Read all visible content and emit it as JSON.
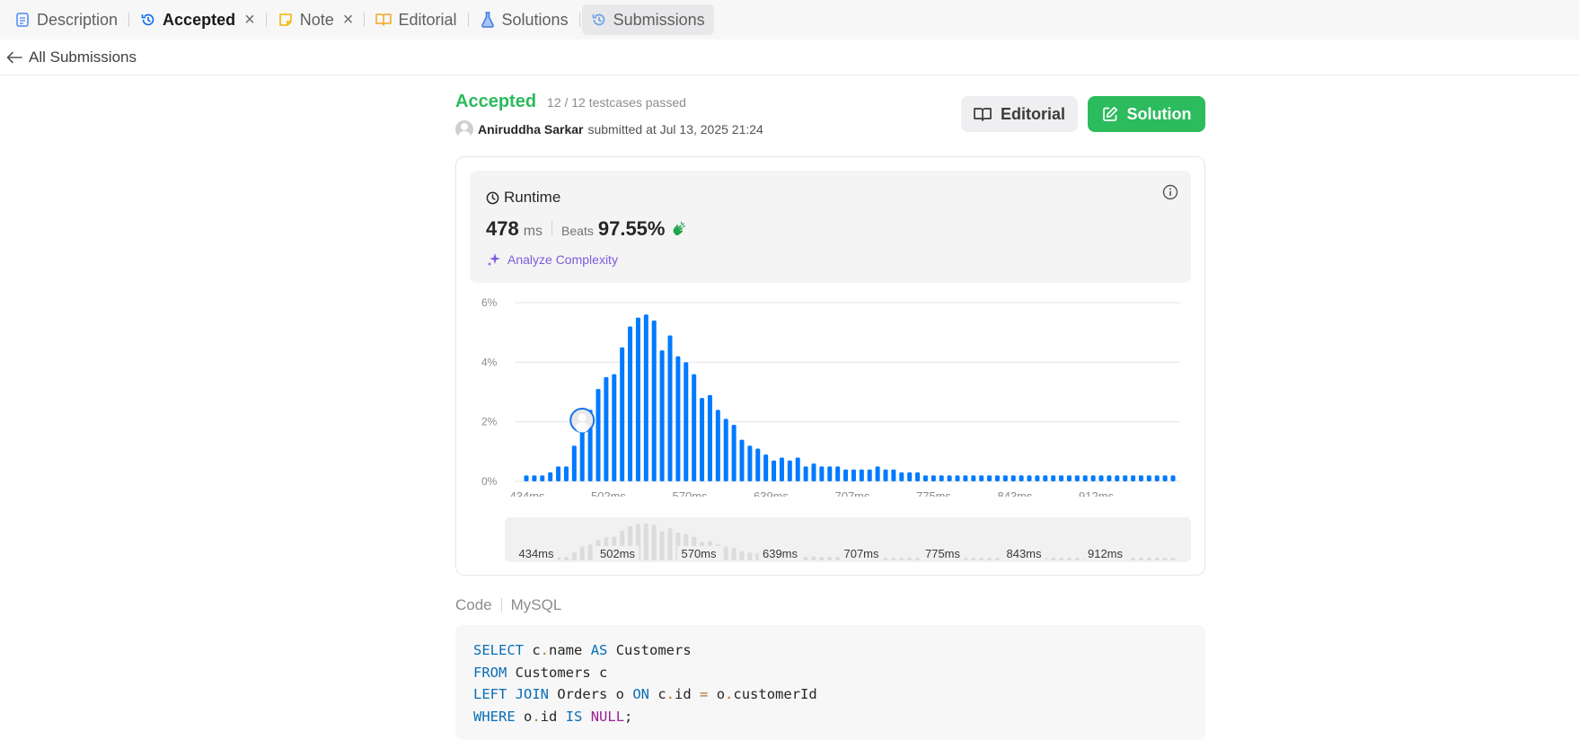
{
  "tabs": [
    {
      "label": "Description",
      "icon": "description-icon"
    },
    {
      "label": "Accepted",
      "icon": "history-icon",
      "active": true,
      "closable": true
    },
    {
      "label": "Note",
      "icon": "note-icon",
      "closable": true
    },
    {
      "label": "Editorial",
      "icon": "book-icon"
    },
    {
      "label": "Solutions",
      "icon": "flask-icon"
    },
    {
      "label": "Submissions",
      "icon": "history-icon",
      "selected": true
    }
  ],
  "subbar": {
    "back_label": "All Submissions"
  },
  "header": {
    "status": "Accepted",
    "testcases": "12 / 12 testcases passed",
    "username": "Aniruddha Sarkar",
    "submitted_text": "submitted at Jul 13, 2025 21:24",
    "editorial_btn": "Editorial",
    "solution_btn": "Solution"
  },
  "runtime": {
    "title": "Runtime",
    "value": "478",
    "unit": "ms",
    "beats_label": "Beats",
    "beats_value": "97.55%",
    "analyze_label": "Analyze Complexity"
  },
  "chart_data": {
    "type": "bar",
    "ylabel": "",
    "xlabel": "",
    "y_ticks": [
      "0%",
      "2%",
      "4%",
      "6%"
    ],
    "ylim": [
      0,
      6
    ],
    "x_tick_labels": [
      "434ms",
      "502ms",
      "570ms",
      "639ms",
      "707ms",
      "775ms",
      "843ms",
      "912ms"
    ],
    "values": [
      0.2,
      0.2,
      0.2,
      0.3,
      0.5,
      0.5,
      1.2,
      2.1,
      2.4,
      3.1,
      3.5,
      3.6,
      4.5,
      5.2,
      5.5,
      5.6,
      5.4,
      4.4,
      4.9,
      4.2,
      4.0,
      3.6,
      2.8,
      2.9,
      2.4,
      2.1,
      1.9,
      1.4,
      1.2,
      1.1,
      0.9,
      0.7,
      0.8,
      0.7,
      0.8,
      0.5,
      0.6,
      0.5,
      0.5,
      0.5,
      0.4,
      0.4,
      0.4,
      0.4,
      0.5,
      0.4,
      0.4,
      0.3,
      0.3,
      0.3,
      0.2,
      0.2,
      0.2,
      0.2,
      0.2,
      0.2,
      0.2,
      0.2,
      0.2,
      0.2,
      0.2,
      0.2,
      0.2,
      0.2,
      0.2,
      0.2,
      0.2,
      0.2,
      0.2,
      0.2,
      0.2,
      0.2,
      0.2,
      0.2,
      0.2,
      0.2,
      0.2,
      0.2,
      0.2,
      0.2,
      0.2,
      0.2
    ],
    "user_bar_index": 7,
    "bar_color": "#007aff",
    "grid": true
  },
  "code": {
    "label": "Code",
    "language": "MySQL",
    "lines": [
      [
        {
          "t": "SELECT",
          "c": "kw"
        },
        {
          "t": " c"
        },
        {
          "t": ".",
          "c": "op"
        },
        {
          "t": "name "
        },
        {
          "t": "AS",
          "c": "kw"
        },
        {
          "t": " Customers"
        }
      ],
      [
        {
          "t": "FROM",
          "c": "kw"
        },
        {
          "t": " Customers c"
        }
      ],
      [
        {
          "t": "LEFT JOIN",
          "c": "kw"
        },
        {
          "t": " Orders o "
        },
        {
          "t": "ON",
          "c": "kw"
        },
        {
          "t": " c"
        },
        {
          "t": ".",
          "c": "op"
        },
        {
          "t": "id "
        },
        {
          "t": "=",
          "c": "op"
        },
        {
          "t": " o"
        },
        {
          "t": ".",
          "c": "op"
        },
        {
          "t": "customerId"
        }
      ],
      [
        {
          "t": "WHERE",
          "c": "kw"
        },
        {
          "t": " o"
        },
        {
          "t": ".",
          "c": "op"
        },
        {
          "t": "id "
        },
        {
          "t": "IS",
          "c": "kw"
        },
        {
          "t": " "
        },
        {
          "t": "NULL",
          "c": "nul"
        },
        {
          "t": ";"
        }
      ]
    ]
  },
  "colors": {
    "accent_green": "#2cbb5d",
    "accent_blue": "#007aff",
    "analyze_purple": "#7c5cdb"
  }
}
